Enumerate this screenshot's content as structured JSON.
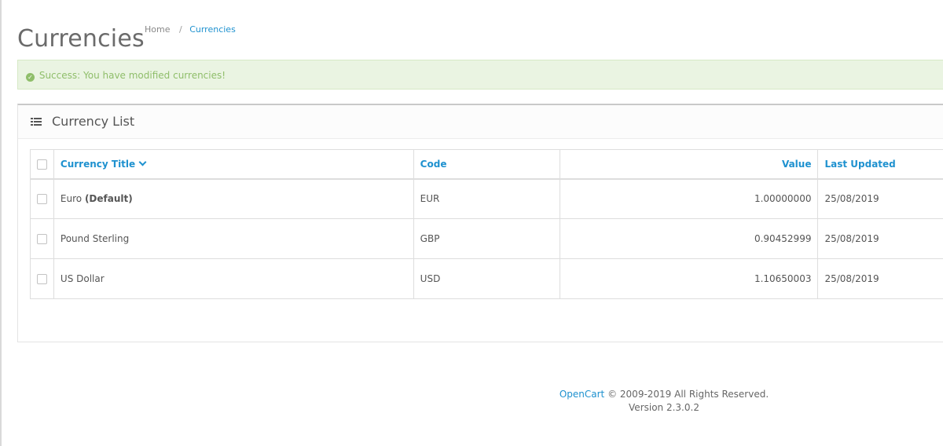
{
  "page": {
    "title": "Currencies",
    "breadcrumb": [
      {
        "label": "Home"
      },
      {
        "label": "Currencies"
      }
    ]
  },
  "alert": {
    "message": "Success: You have modified currencies!",
    "icon": "check-circle-icon",
    "color": "#8fbe6a"
  },
  "panel": {
    "title": "Currency List",
    "icon": "list-icon"
  },
  "table": {
    "headers": {
      "title": "Currency Title",
      "code": "Code",
      "value": "Value",
      "updated": "Last Updated"
    },
    "sort_icon": "chevron-down-icon",
    "rows": [
      {
        "title": "Euro",
        "default": "(Default)",
        "code": "EUR",
        "value": "1.00000000",
        "updated": "25/08/2019"
      },
      {
        "title": "Pound Sterling",
        "default": "",
        "code": "GBP",
        "value": "0.90452999",
        "updated": "25/08/2019"
      },
      {
        "title": "US Dollar",
        "default": "",
        "code": "USD",
        "value": "1.10650003",
        "updated": "25/08/2019"
      }
    ]
  },
  "footer": {
    "brand": "OpenCart",
    "copyright": "© 2009-2019 All Rights Reserved.",
    "version": "Version 2.3.0.2"
  },
  "colors": {
    "link": "#1e91cf",
    "success_bg": "#eaf4e2"
  }
}
